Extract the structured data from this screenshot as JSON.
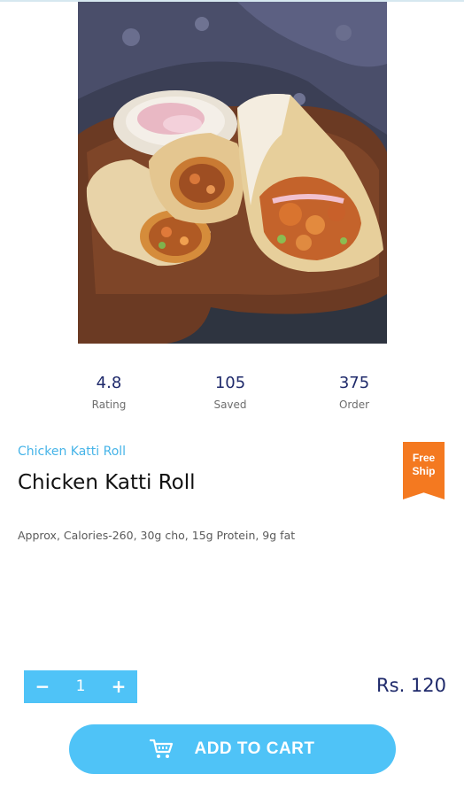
{
  "product": {
    "image_icon": "food-photo",
    "subtitle": "Chicken Katti Roll",
    "title": "Chicken Katti Roll",
    "description": "Approx, Calories-260, 30g cho, 15g Protein, 9g fat",
    "badge": {
      "line1": "Free",
      "line2": "Ship",
      "color": "#f47920"
    }
  },
  "stats": [
    {
      "value": "4.8",
      "label": "Rating"
    },
    {
      "value": "105",
      "label": "Saved"
    },
    {
      "value": "375",
      "label": "Order"
    }
  ],
  "cart": {
    "minus_label": "−",
    "quantity": "1",
    "plus_label": "+",
    "price": "Rs. 120",
    "add_to_cart_label": "ADD TO CART",
    "cart_icon": "cart-icon"
  },
  "colors": {
    "accent": "#4fc3f7",
    "subtitle": "#46b4e8",
    "stat_value": "#1f2a6b",
    "badge": "#f47920"
  }
}
